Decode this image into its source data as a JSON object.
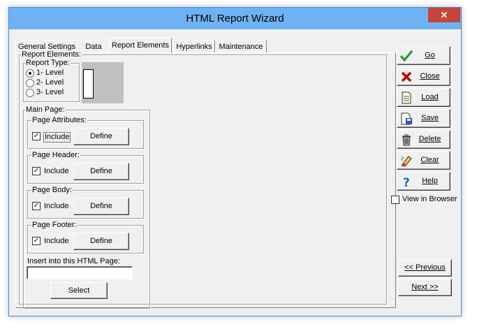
{
  "window": {
    "title": "HTML Report Wizard",
    "close_glyph": "✕"
  },
  "tabs": [
    {
      "label": "General Settings"
    },
    {
      "label": "Data"
    },
    {
      "label": "Report Elements"
    },
    {
      "label": "Hyperlinks"
    },
    {
      "label": "Maintenance"
    }
  ],
  "active_tab": "Report Elements",
  "report_elements": {
    "group_label": "Report Elements:",
    "report_type": {
      "label": "Report Type:",
      "options": [
        "1- Level",
        "2- Level",
        "3- Level"
      ],
      "selected": "1- Level"
    }
  },
  "main_page": {
    "group_label": "Main Page:",
    "sections": [
      {
        "label": "Page Attributes:",
        "include_label": "Include",
        "include_checked": true,
        "define_label": "Define"
      },
      {
        "label": "Page Header:",
        "include_label": "Include",
        "include_checked": true,
        "define_label": "Define"
      },
      {
        "label": "Page Body:",
        "include_label": "Include",
        "include_checked": true,
        "define_label": "Define"
      },
      {
        "label": "Page Footer:",
        "include_label": "Include",
        "include_checked": true,
        "define_label": "Define"
      }
    ],
    "insert_label": "Insert into this HTML Page:",
    "insert_value": "",
    "select_label": "Select"
  },
  "actions": [
    {
      "label": "Go",
      "icon": "checkmark-icon"
    },
    {
      "label": "Close",
      "icon": "red-x-icon"
    },
    {
      "label": "Load",
      "icon": "document-icon"
    },
    {
      "label": "Save",
      "icon": "save-document-icon"
    },
    {
      "label": "Delete",
      "icon": "trash-can-icon"
    },
    {
      "label": "Clear",
      "icon": "eraser-icon"
    },
    {
      "label": "Help",
      "icon": "question-mark-icon"
    }
  ],
  "view_in_browser": {
    "label": "View in Browser",
    "checked": false
  },
  "navigation": {
    "previous_label": "<< Previous",
    "next_label": "Next >>"
  },
  "colors": {
    "title_bar": "#6fb2f3",
    "close_button": "#c7443a",
    "dialog_bg": "#f0f0f0",
    "preview_bg": "#c0c0c0"
  }
}
